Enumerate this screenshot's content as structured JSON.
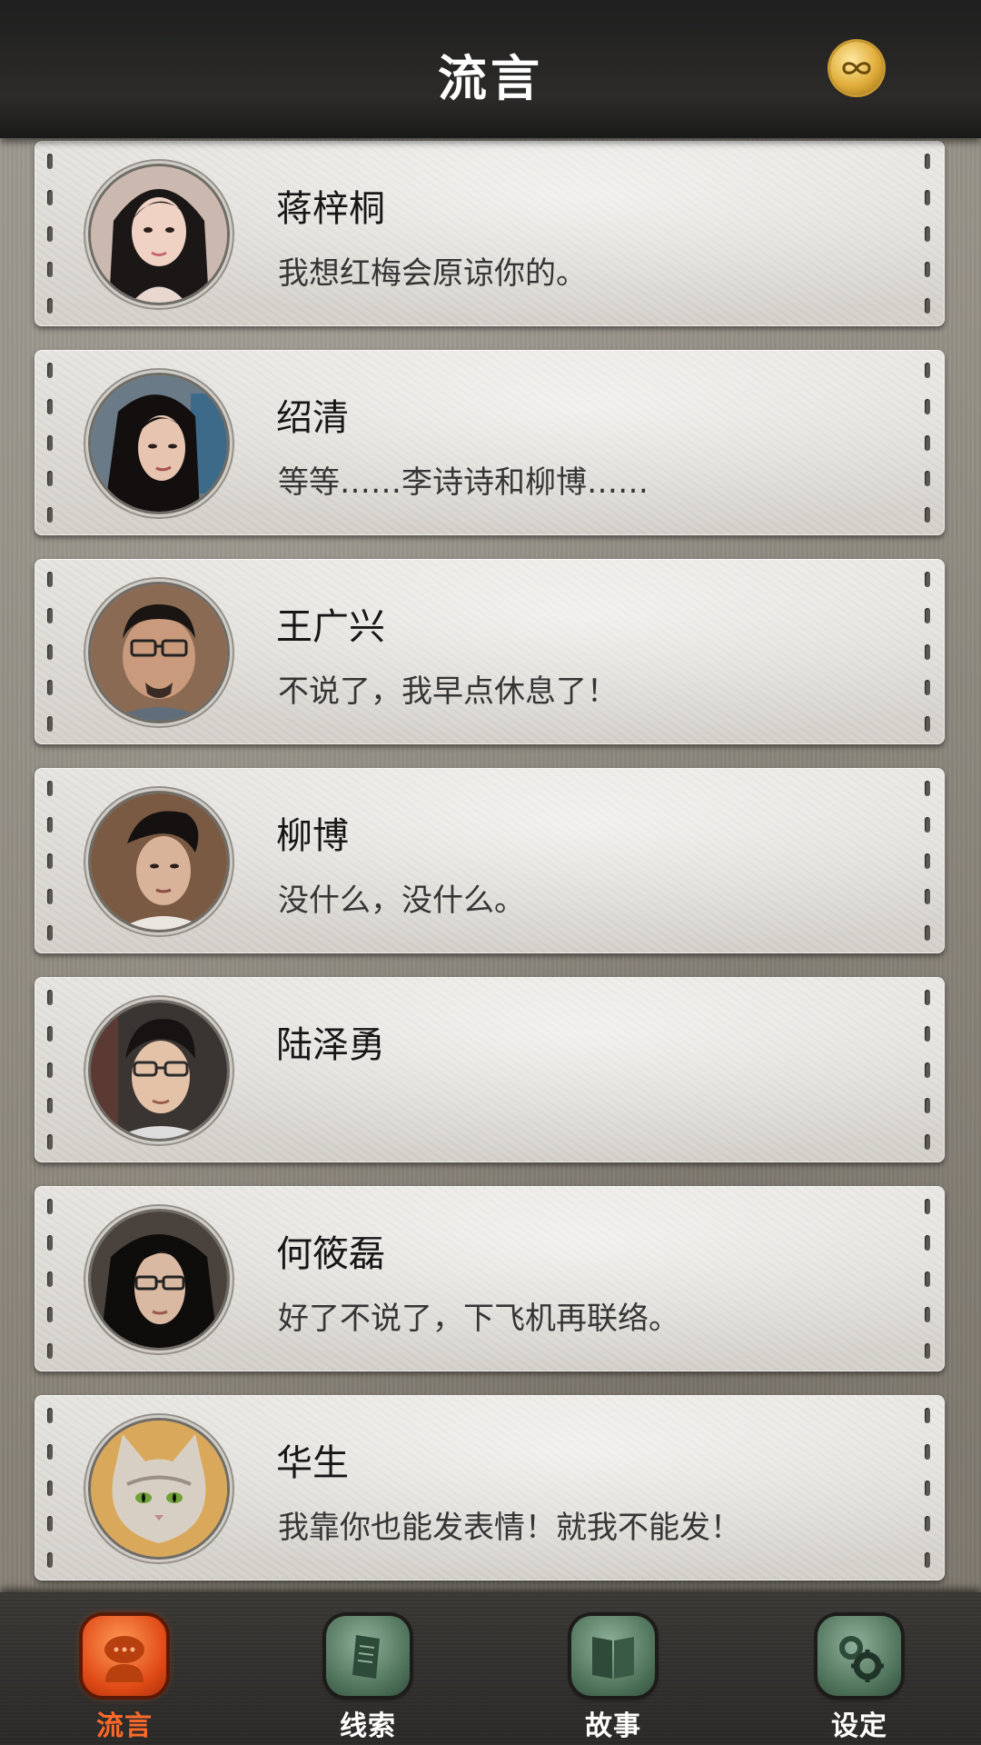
{
  "header": {
    "title": "流言",
    "badge_icon": "infinity-coin-icon"
  },
  "contacts": [
    {
      "name": "蒋梓桐",
      "message": "我想红梅会原谅你的。",
      "avatar": "woman-portrait-long-hair"
    },
    {
      "name": "绍清",
      "message": "等等……李诗诗和柳博……",
      "avatar": "woman-portrait-dark-hair"
    },
    {
      "name": "王广兴",
      "message": "不说了，我早点休息了！",
      "avatar": "man-portrait-glasses-beard"
    },
    {
      "name": "柳博",
      "message": "没什么，没什么。",
      "avatar": "man-portrait-slick-hair"
    },
    {
      "name": "陆泽勇",
      "message": "",
      "avatar": "man-portrait-glasses"
    },
    {
      "name": "何筱磊",
      "message": "好了不说了，下飞机再联络。",
      "avatar": "man-portrait-long-hair-glasses"
    },
    {
      "name": "华生",
      "message": "我靠你也能发表情！就我不能发！",
      "avatar": "cat-portrait"
    }
  ],
  "tabs": [
    {
      "label": "流言",
      "icon": "chat-bubble-icon",
      "active": true
    },
    {
      "label": "线索",
      "icon": "document-icon",
      "active": false
    },
    {
      "label": "故事",
      "icon": "book-icon",
      "active": false
    },
    {
      "label": "设定",
      "icon": "gear-icon",
      "active": false
    }
  ],
  "colors": {
    "header_bg": "#2c2b29",
    "active_tab": "#ff6a2a",
    "inactive_tab_icon": "#4c6f57",
    "badge_gold": "#e0ad3a"
  }
}
